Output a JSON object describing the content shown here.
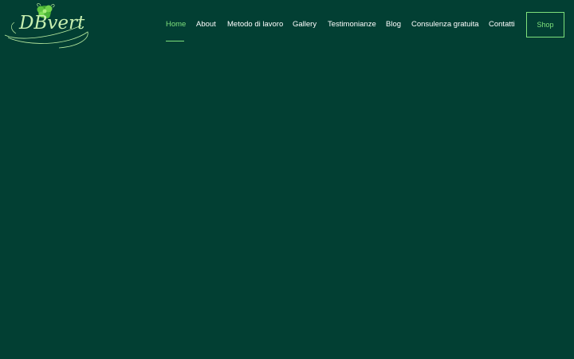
{
  "brand": {
    "logo_text": "DBvert"
  },
  "nav": {
    "items": [
      {
        "label": "Home",
        "active": true
      },
      {
        "label": "About"
      },
      {
        "label": "Metodo di lavoro"
      },
      {
        "label": "Gallery"
      },
      {
        "label": "Testimonianze"
      },
      {
        "label": "Blog"
      },
      {
        "label": "Consulenza gratuita"
      },
      {
        "label": "Contatti"
      }
    ],
    "shop_label": "Shop"
  },
  "colors": {
    "background": "#023f33",
    "accent": "#7ee07c",
    "nav_text": "#ffffff"
  },
  "icons": {
    "logo": "leaf-logo-icon"
  }
}
